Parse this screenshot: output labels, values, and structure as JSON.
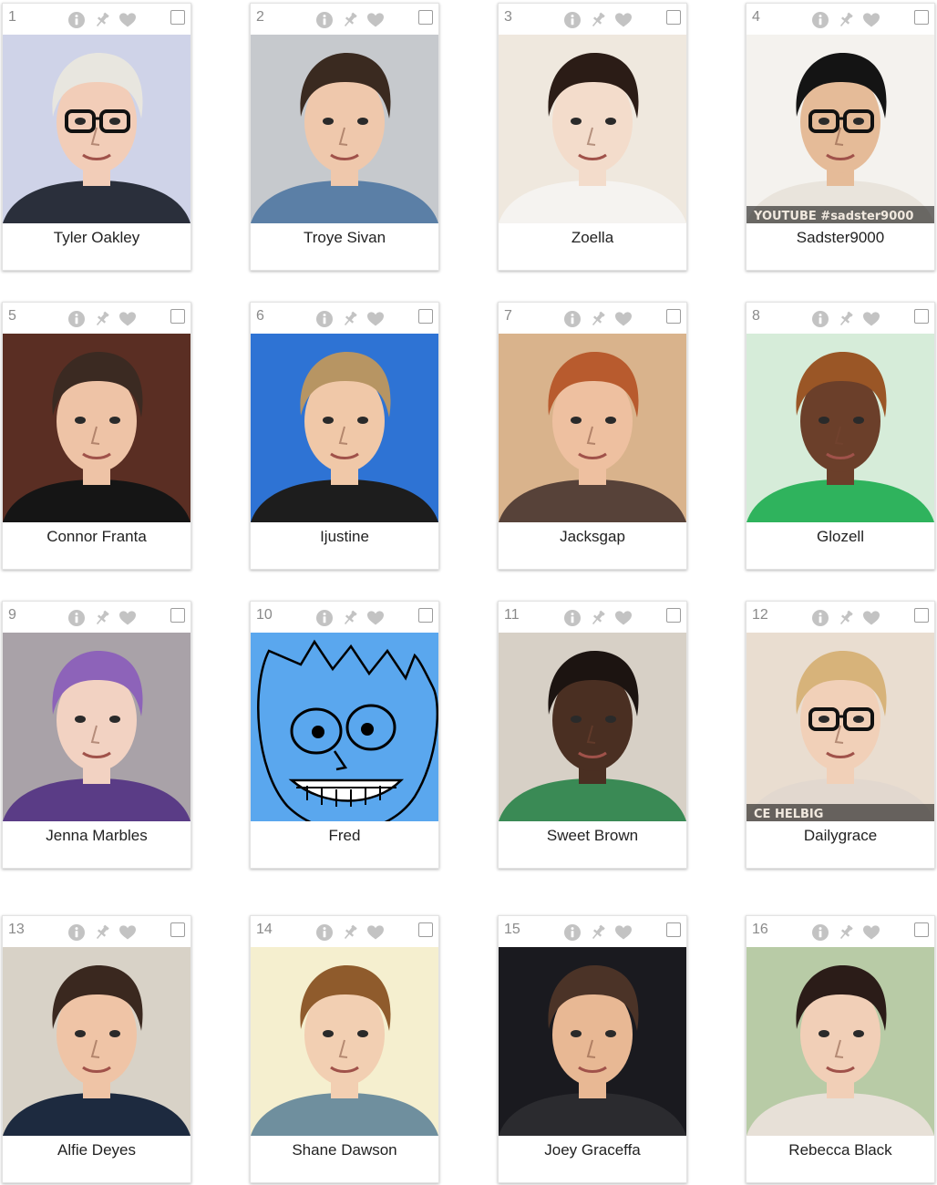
{
  "cards": [
    {
      "rank": "1",
      "name": "Tyler Oakley",
      "bg": "#cfd3e8",
      "skin": "#f2cdb8",
      "hair": "#e8e6df",
      "shirt": "#2a2f3b",
      "glasses": true
    },
    {
      "rank": "2",
      "name": "Troye Sivan",
      "bg": "#c6c9cd",
      "skin": "#efc8ac",
      "hair": "#3a2a20",
      "shirt": "#5b7fa6"
    },
    {
      "rank": "3",
      "name": "Zoella",
      "bg": "#efe8de",
      "skin": "#f3dccb",
      "hair": "#2b1c16",
      "shirt": "#f5f3f0"
    },
    {
      "rank": "4",
      "name": "Sadster9000",
      "bg": "#f4f2ee",
      "skin": "#e5bb98",
      "hair": "#141414",
      "shirt": "#e9e4dc",
      "glasses": true,
      "caption": "YOUTUBE #sadster9000"
    },
    {
      "rank": "5",
      "name": "Connor Franta",
      "bg": "#5a2e23",
      "skin": "#eec3a6",
      "hair": "#3b2a22",
      "shirt": "#151515"
    },
    {
      "rank": "6",
      "name": "Ijustine",
      "bg": "#2e73d4",
      "skin": "#f0c8a8",
      "hair": "#b79563",
      "shirt": "#1d1d1d"
    },
    {
      "rank": "7",
      "name": "Jacksgap",
      "bg": "#d9b38c",
      "skin": "#eec0a0",
      "hair": "#b85b2e",
      "shirt": "#574239"
    },
    {
      "rank": "8",
      "name": "Glozell",
      "bg": "#d6ecd9",
      "skin": "#6b3f2a",
      "hair": "#9a5626",
      "shirt": "#2fb35d"
    },
    {
      "rank": "9",
      "name": "Jenna Marbles",
      "bg": "#a9a2a8",
      "skin": "#f2d2c2",
      "hair": "#8d63b9",
      "shirt": "#5a3c86"
    },
    {
      "rank": "10",
      "name": "Fred",
      "bg": "#5aa7ee",
      "cartoon": true
    },
    {
      "rank": "11",
      "name": "Sweet Brown",
      "bg": "#d7d0c6",
      "skin": "#4a2f22",
      "hair": "#1c1411",
      "shirt": "#3a8a55"
    },
    {
      "rank": "12",
      "name": "Dailygrace",
      "bg": "#e9ddd0",
      "skin": "#f1d0b8",
      "hair": "#d7b37a",
      "shirt": "#e2d8cf",
      "glasses": true,
      "caption": "CE HELBIG"
    },
    {
      "rank": "13",
      "name": "Alfie Deyes",
      "bg": "#d8d2c7",
      "skin": "#efc4a6",
      "hair": "#3a281f",
      "shirt": "#1d2a3f"
    },
    {
      "rank": "14",
      "name": "Shane Dawson",
      "bg": "#f5efcf",
      "skin": "#f2cfb2",
      "hair": "#8f5b2c",
      "shirt": "#6f8f9e"
    },
    {
      "rank": "15",
      "name": "Joey Graceffa",
      "bg": "#1a1a1f",
      "skin": "#e8b894",
      "hair": "#4b3327",
      "shirt": "#2b2b2f"
    },
    {
      "rank": "16",
      "name": "Rebecca Black",
      "bg": "#b8cba6",
      "skin": "#f1cfb7",
      "hair": "#2b1c18",
      "shirt": "#e7e0d7"
    }
  ]
}
